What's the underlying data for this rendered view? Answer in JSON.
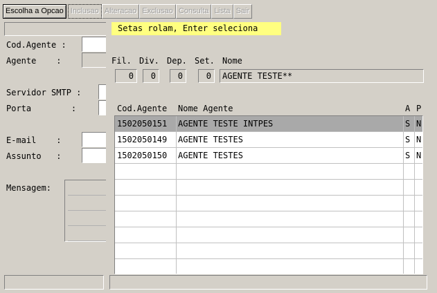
{
  "toolbar": {
    "items": [
      "Escolha a Opcao",
      "Inclusao",
      "Alteracao",
      "Exclusao",
      "Consulta",
      "Lista",
      "Sair"
    ]
  },
  "form": {
    "cod_agente_label": "Cod.Agente :",
    "agente_label": "Agente    :",
    "servidor_label": "Servidor SMTP :",
    "porta_label": "Porta        :",
    "email_label": "E-mail    :",
    "assunto_label": "Assunto   :",
    "mensagem_label": "Mensagem:"
  },
  "popup": {
    "hint": "Setas rolam, Enter seleciona",
    "filter_headers": {
      "fil": "Fil.",
      "div": "Div.",
      "dep": "Dep.",
      "set": "Set.",
      "nome": "Nome"
    },
    "filter_values": {
      "fil": "0",
      "div": "0",
      "dep": "0",
      "set": "0",
      "nome": "AGENTE TESTE**"
    },
    "columns": {
      "cod": "Cod.Agente",
      "nome": "Nome Agente",
      "a": "A",
      "p": "P"
    },
    "rows": [
      {
        "cod": "1502050151",
        "nome": "AGENTE TESTE INTPES",
        "a": "S",
        "p": "N"
      },
      {
        "cod": "1502050149",
        "nome": "AGENTE TESTES",
        "a": "S",
        "p": "N"
      },
      {
        "cod": "1502050150",
        "nome": "AGENTE TESTES",
        "a": "S",
        "p": "N"
      }
    ]
  }
}
